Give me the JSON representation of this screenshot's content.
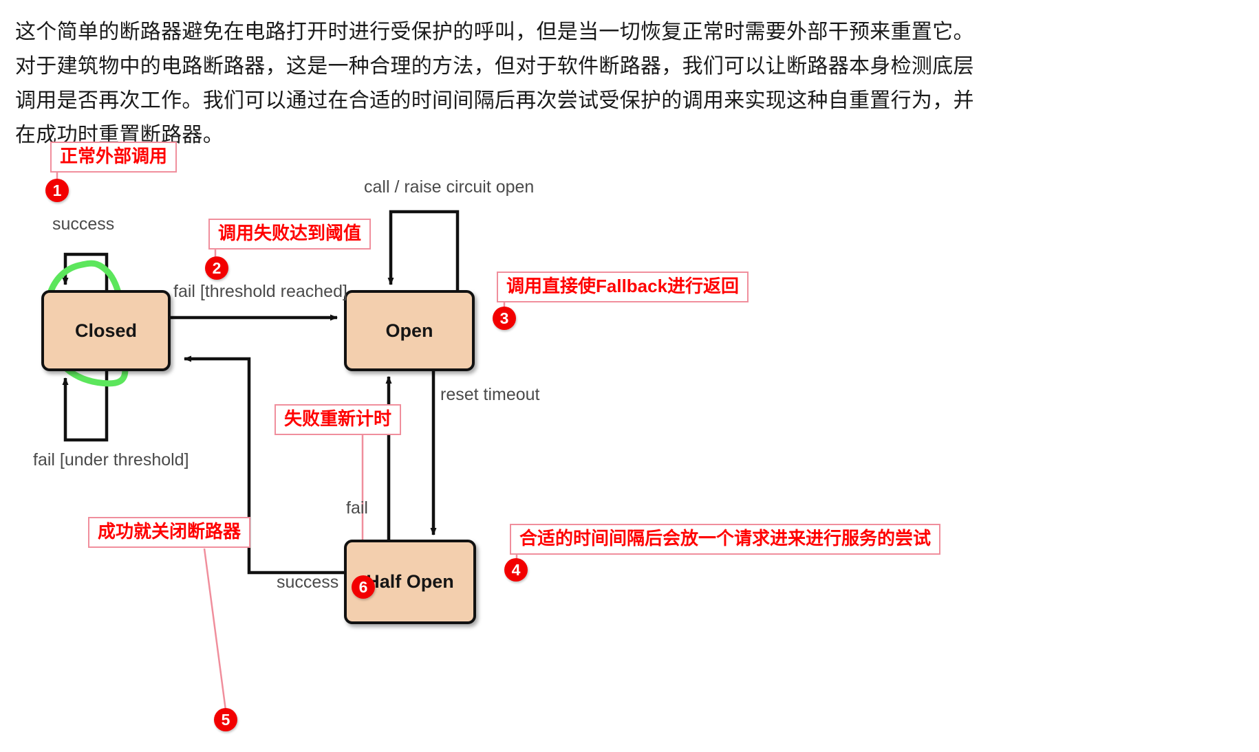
{
  "prose": {
    "text": "这个简单的断路器避免在电路打开时进行受保护的呼叫，但是当一切恢复正常时需要外部干预来重置它。对于建筑物中的电路断路器，这是一种合理的方法，但对于软件断路器，我们可以让断路器本身检测底层调用是否再次工作。我们可以通过在合适的时间间隔后再次尝试受保护的调用来实现这种自重置行为，并在成功时重置断路器。"
  },
  "diagram": {
    "type": "state-machine",
    "states": [
      {
        "id": "closed",
        "label": "Closed"
      },
      {
        "id": "open",
        "label": "Open"
      },
      {
        "id": "half_open",
        "label": "Half Open"
      }
    ],
    "transitions": [
      {
        "from": "closed",
        "to": "closed",
        "label": "success"
      },
      {
        "from": "closed",
        "to": "open",
        "label": "fail [threshold reached]"
      },
      {
        "from": "open",
        "to": "open",
        "label": "call / raise circuit open"
      },
      {
        "from": "closed",
        "to": "closed",
        "label": "fail [under threshold]"
      },
      {
        "from": "open",
        "to": "half_open",
        "label": "reset timeout"
      },
      {
        "from": "half_open",
        "to": "open",
        "label": "fail"
      },
      {
        "from": "half_open",
        "to": "closed",
        "label": "success"
      }
    ],
    "labels": {
      "success_top": "success",
      "fail_threshold_reached": "fail [threshold reached]",
      "call_raise_circuit_open": "call / raise circuit open",
      "reset_timeout": "reset timeout",
      "fail_under_threshold": "fail [under threshold]",
      "fail_half_open": "fail",
      "success_bottom": "success"
    },
    "colors": {
      "state_fill": "#f3cfae",
      "state_border": "#111111",
      "edge": "#1a1a1a",
      "edge_label": "#4a4a4a",
      "annotation_red": "#ff0000",
      "annotation_border": "#f08e9c",
      "marker_fill": "#f20000",
      "highlight_green": "#5ce65c"
    }
  },
  "annotations": [
    {
      "number": "1",
      "text": "正常外部调用"
    },
    {
      "number": "2",
      "text": "调用失败达到阈值"
    },
    {
      "number": "3",
      "text": "调用直接使Fallback进行返回"
    },
    {
      "number": "4",
      "text": "合适的时间间隔后会放一个请求进来进行服务的尝试"
    },
    {
      "number": "5",
      "text": "成功就关闭断路器"
    },
    {
      "number": "6",
      "text": "失败重新计时"
    }
  ]
}
